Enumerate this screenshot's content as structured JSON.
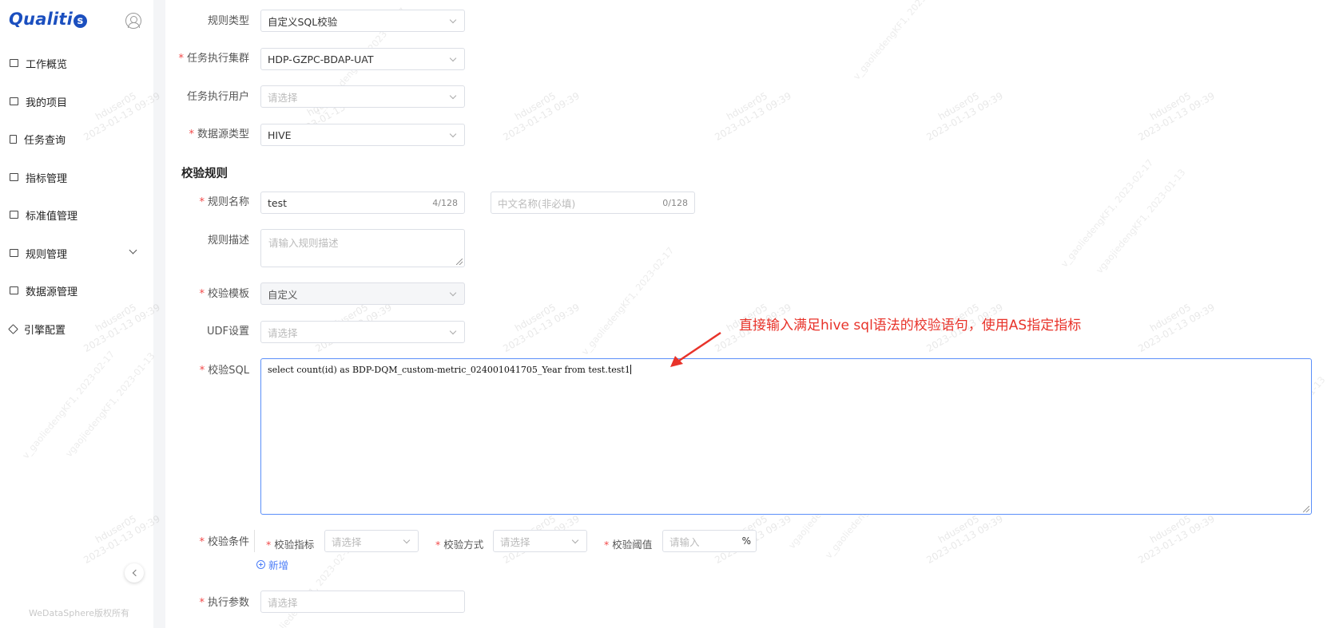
{
  "app": {
    "logo_text": "Qualiti",
    "logo_badge": "s",
    "copyright": "WeDataSphere版权所有"
  },
  "sidebar": {
    "items": [
      {
        "label": "工作概览"
      },
      {
        "label": "我的项目"
      },
      {
        "label": "任务查询"
      },
      {
        "label": "指标管理"
      },
      {
        "label": "标准值管理"
      },
      {
        "label": "规则管理"
      },
      {
        "label": "数据源管理"
      },
      {
        "label": "引擎配置"
      }
    ]
  },
  "form": {
    "rule_type": {
      "label": "规则类型",
      "value": "自定义SQL校验"
    },
    "cluster": {
      "label": "任务执行集群",
      "value": "HDP-GZPC-BDAP-UAT"
    },
    "exec_user": {
      "label": "任务执行用户",
      "placeholder": "请选择"
    },
    "datasource_type": {
      "label": "数据源类型",
      "value": "HIVE"
    },
    "section_title": "校验规则",
    "rule_name": {
      "label": "规则名称",
      "value": "test",
      "counter": "4/128"
    },
    "cn_name": {
      "placeholder": "中文名称(非必填)",
      "counter": "0/128"
    },
    "rule_desc": {
      "label": "规则描述",
      "placeholder": "请输入规则描述"
    },
    "template": {
      "label": "校验模板",
      "value": "自定义"
    },
    "udf": {
      "label": "UDF设置",
      "placeholder": "请选择"
    },
    "sql": {
      "label": "校验SQL",
      "value": "select count(id) as BDP-DQM_custom-metric_024001041705_Year from test.test1"
    },
    "condition": {
      "label": "校验条件",
      "metric_label": "校验指标",
      "metric_placeholder": "请选择",
      "method_label": "校验方式",
      "method_placeholder": "请选择",
      "threshold_label": "校验阈值",
      "threshold_placeholder": "请输入",
      "threshold_suffix": "%",
      "add_label": "新增"
    },
    "exec_params": {
      "label": "执行参数",
      "placeholder": "请选择"
    }
  },
  "annotation": {
    "text": "直接输入满足hive sql语法的校验语句，使用AS指定指标",
    "color": "#e8332a"
  },
  "watermark": {
    "user": "hduser05",
    "time": "2023-01-13 09:39",
    "alt": "v_gaoliedengKF1, 2023-02-17",
    "alt2": "vgaojiedengKF1, 2023-01-13"
  }
}
